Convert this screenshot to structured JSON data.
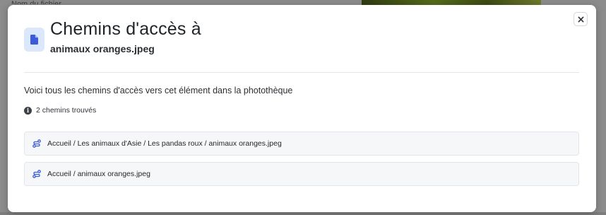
{
  "background": {
    "label": "Nom du fichier"
  },
  "modal": {
    "title": "Chemins d'accès à",
    "filename": "animaux oranges.jpeg",
    "description": "Voici tous les chemins d'accès vers cet élément dans la photothèque",
    "found_text": "2 chemins trouvés",
    "close_icon": "close-icon",
    "file_icon": "file-icon",
    "info_icon": "info-icon",
    "path_icon": "route-icon",
    "paths": [
      "Accueil / Les animaux d'Asie / Les pandas roux / animaux oranges.jpeg",
      "Accueil / animaux oranges.jpeg"
    ]
  },
  "colors": {
    "accent": "#3b5bdb",
    "badge_bg": "#dbe7fb",
    "overlay": "#8c8c8c",
    "row_bg": "#f6f7f8"
  }
}
